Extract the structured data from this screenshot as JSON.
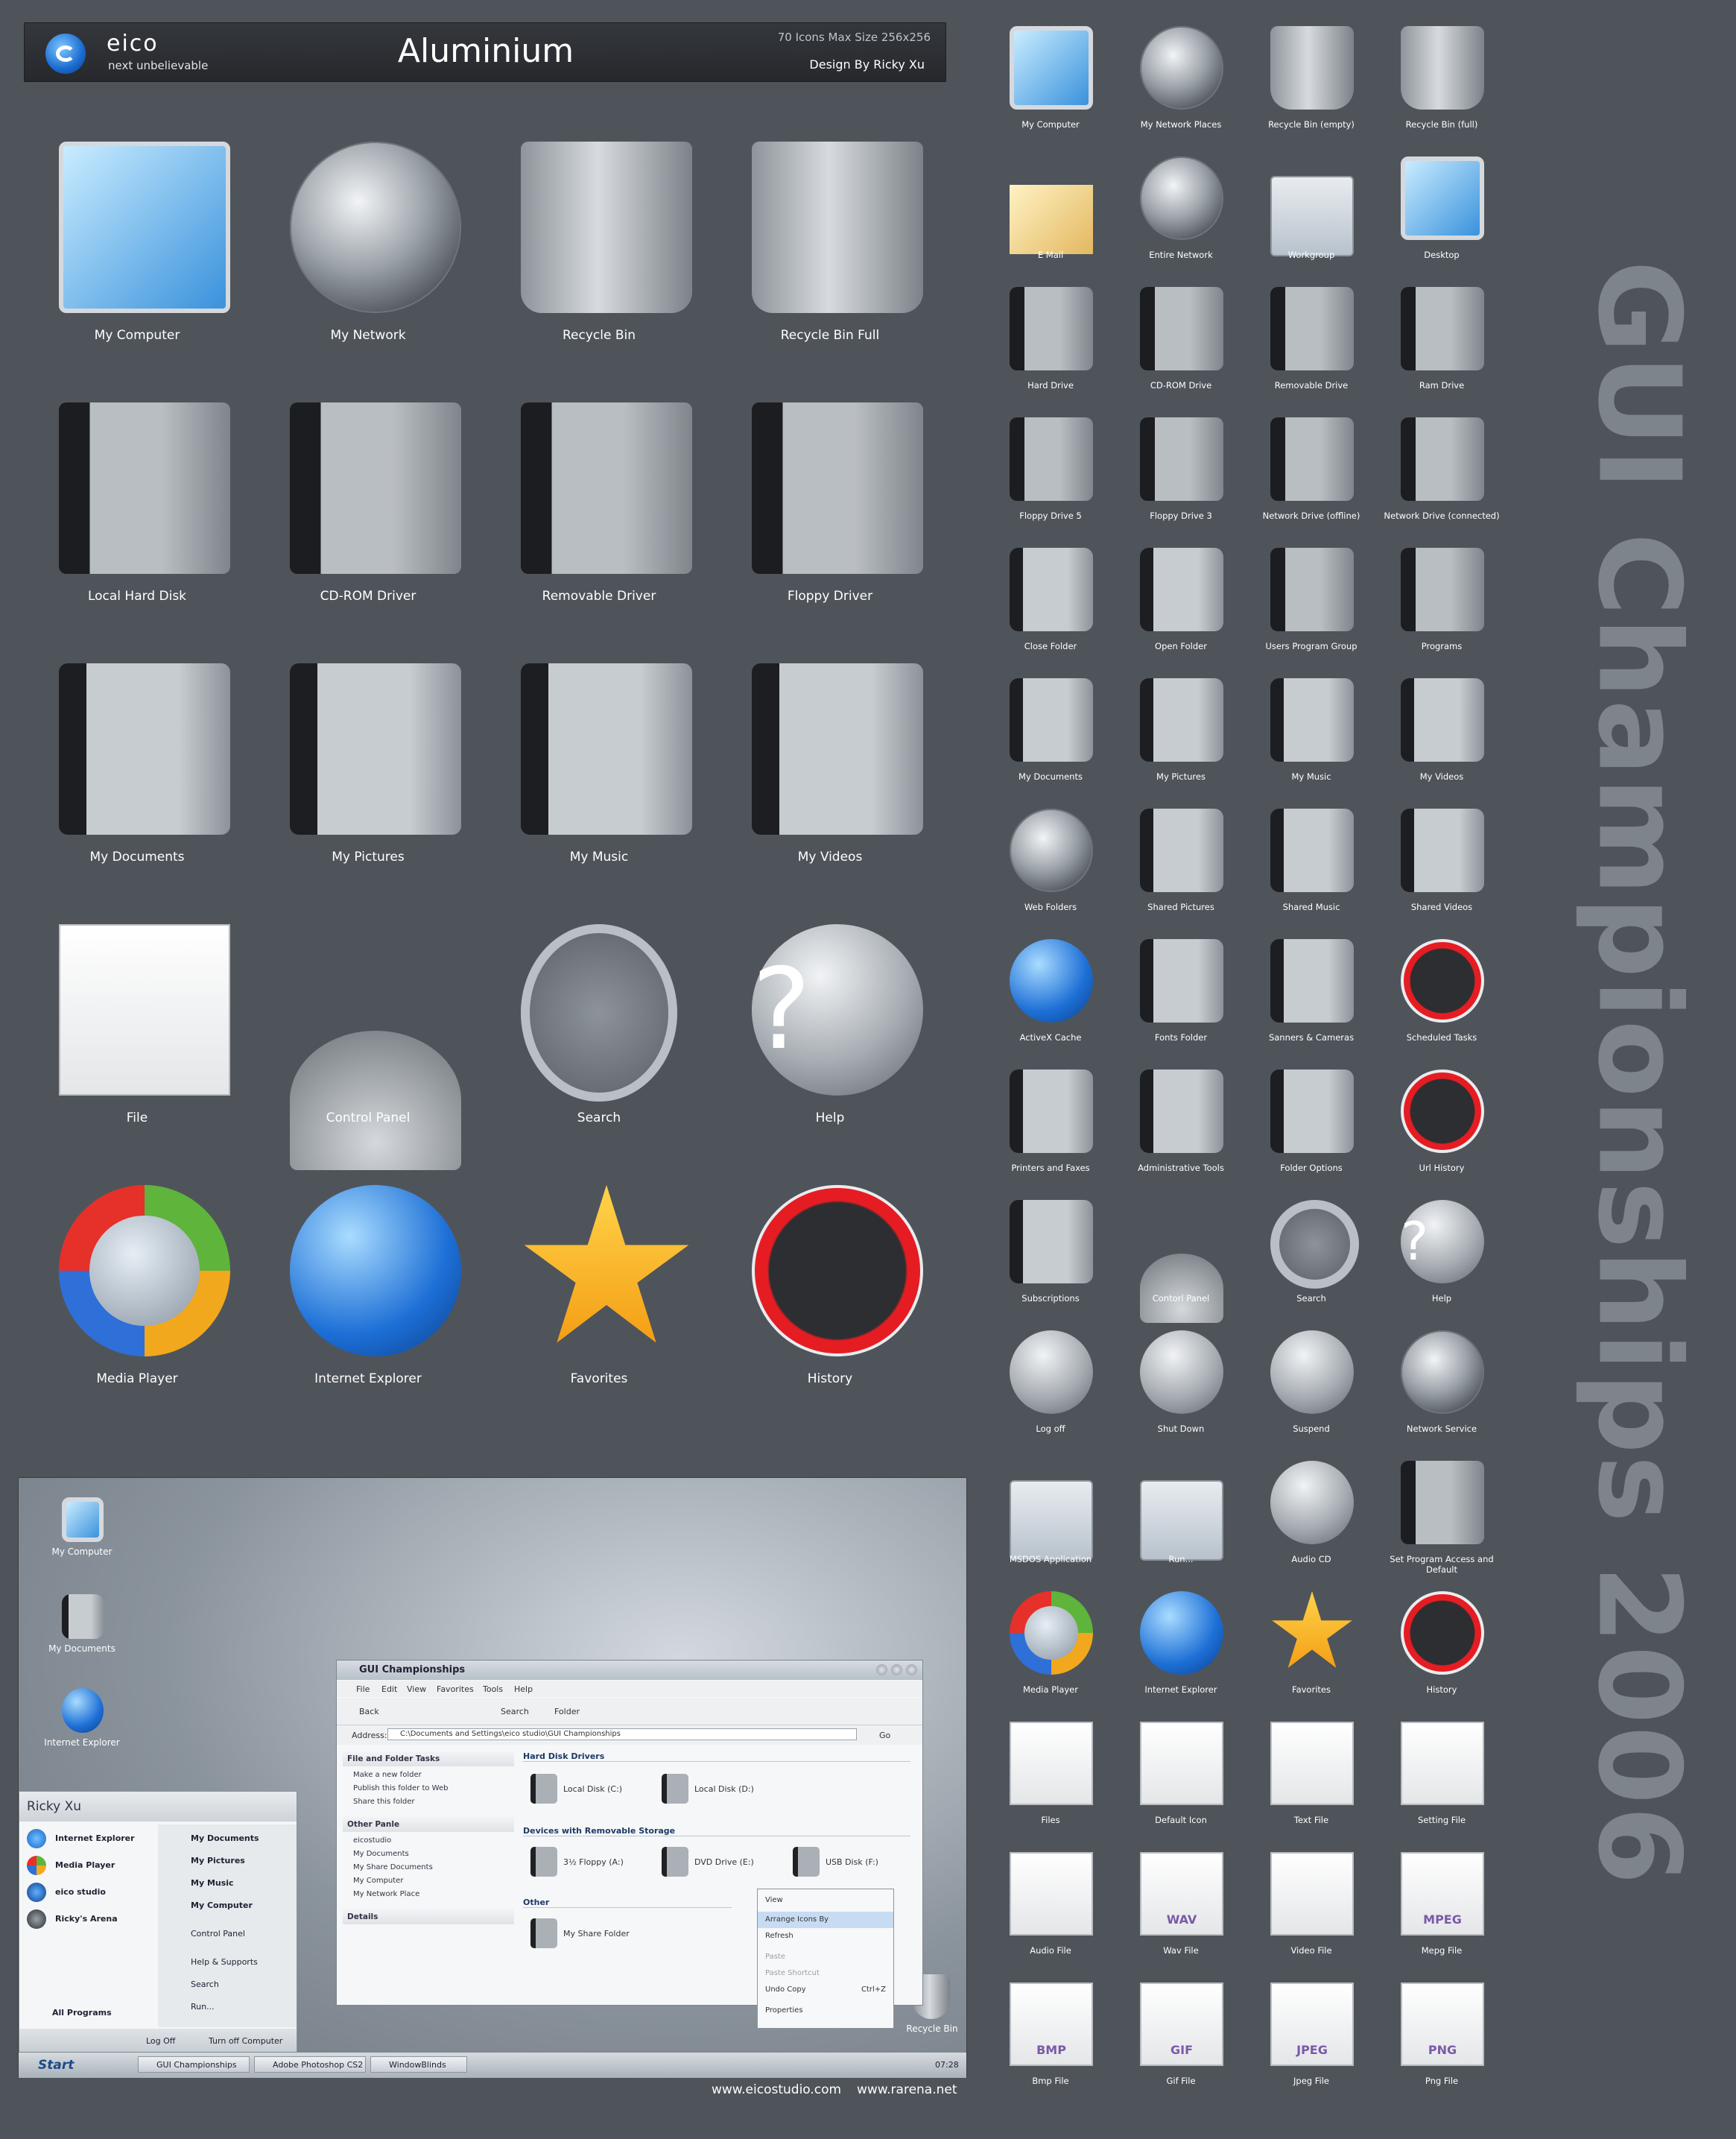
{
  "header": {
    "brand": "eico",
    "tagline": "next unbelievable",
    "title": "Aluminium",
    "meta_size": "70 Icons Max Size 256x256",
    "meta_design": "Design By Ricky Xu"
  },
  "side_title": "GUI Championships 2006",
  "big_icons": [
    {
      "label": "My Computer",
      "icon": "monitor-icon"
    },
    {
      "label": "My Network",
      "icon": "globe-icon"
    },
    {
      "label": "Recycle Bin",
      "icon": "recycle-bin-icon"
    },
    {
      "label": "Recycle Bin Full",
      "icon": "recycle-bin-full-icon"
    },
    {
      "label": "Local Hard Disk",
      "icon": "hard-disk-icon"
    },
    {
      "label": "CD-ROM Driver",
      "icon": "cdrom-drive-icon"
    },
    {
      "label": "Removable Driver",
      "icon": "usb-drive-icon"
    },
    {
      "label": "Floppy Driver",
      "icon": "floppy-drive-icon"
    },
    {
      "label": "My Documents",
      "icon": "documents-folder-icon"
    },
    {
      "label": "My Pictures",
      "icon": "pictures-folder-icon"
    },
    {
      "label": "My Music",
      "icon": "music-folder-icon"
    },
    {
      "label": "My Videos",
      "icon": "videos-folder-icon"
    },
    {
      "label": "File",
      "icon": "file-icon"
    },
    {
      "label": "Control Panel",
      "icon": "joystick-icon"
    },
    {
      "label": "Search",
      "icon": "magnifier-icon"
    },
    {
      "label": "Help",
      "icon": "help-icon"
    },
    {
      "label": "Media Player",
      "icon": "media-player-icon"
    },
    {
      "label": "Internet Explorer",
      "icon": "internet-explorer-icon"
    },
    {
      "label": "Favorites",
      "icon": "star-icon"
    },
    {
      "label": "History",
      "icon": "clock-icon"
    }
  ],
  "small_icons": [
    {
      "label": "My Computer",
      "icon": "monitor-icon"
    },
    {
      "label": "My Network Places",
      "icon": "globe-icon"
    },
    {
      "label": "Recycle Bin (empty)",
      "icon": "recycle-bin-icon"
    },
    {
      "label": "Recycle Bin (full)",
      "icon": "recycle-bin-full-icon"
    },
    {
      "label": "E Mail",
      "icon": "envelope-icon"
    },
    {
      "label": "Entire Network",
      "icon": "globe-icon"
    },
    {
      "label": "Workgroup",
      "icon": "workgroup-icon"
    },
    {
      "label": "Desktop",
      "icon": "desktop-icon"
    },
    {
      "label": "Hard Drive",
      "icon": "hard-disk-icon"
    },
    {
      "label": "CD-ROM Drive",
      "icon": "cdrom-drive-icon"
    },
    {
      "label": "Removable Drive",
      "icon": "usb-drive-icon"
    },
    {
      "label": "Ram Drive",
      "icon": "ram-drive-icon"
    },
    {
      "label": "Floppy Drive 5",
      "icon": "floppy-5-icon"
    },
    {
      "label": "Floppy Drive 3",
      "icon": "floppy-3-icon"
    },
    {
      "label": "Network Drive (offline)",
      "icon": "network-drive-offline-icon"
    },
    {
      "label": "Network Drive (connected)",
      "icon": "network-drive-connected-icon"
    },
    {
      "label": "Close Folder",
      "icon": "closed-folder-icon"
    },
    {
      "label": "Open Folder",
      "icon": "open-folder-icon"
    },
    {
      "label": "Users Program Group",
      "icon": "program-group-icon"
    },
    {
      "label": "Programs",
      "icon": "programs-icon"
    },
    {
      "label": "My Documents",
      "icon": "documents-folder-icon"
    },
    {
      "label": "My Pictures",
      "icon": "pictures-folder-icon"
    },
    {
      "label": "My Music",
      "icon": "music-folder-icon"
    },
    {
      "label": "My Videos",
      "icon": "videos-folder-icon"
    },
    {
      "label": "Web Folders",
      "icon": "web-folder-icon"
    },
    {
      "label": "Shared Pictures",
      "icon": "shared-pictures-icon"
    },
    {
      "label": "Shared Music",
      "icon": "shared-music-icon"
    },
    {
      "label": "Shared Videos",
      "icon": "shared-videos-icon"
    },
    {
      "label": "ActiveX Cache",
      "icon": "activex-folder-icon"
    },
    {
      "label": "Fonts Folder",
      "icon": "fonts-folder-icon"
    },
    {
      "label": "Sanners & Cameras",
      "icon": "camera-folder-icon"
    },
    {
      "label": "Scheduled Tasks",
      "icon": "scheduled-tasks-icon"
    },
    {
      "label": "Printers and Faxes",
      "icon": "printers-folder-icon"
    },
    {
      "label": "Administrative Tools",
      "icon": "admin-tools-icon"
    },
    {
      "label": "Folder Options",
      "icon": "folder-options-icon"
    },
    {
      "label": "Url History",
      "icon": "url-history-icon"
    },
    {
      "label": "Subscriptions",
      "icon": "subscriptions-icon"
    },
    {
      "label": "Contorl Panel",
      "icon": "joystick-icon"
    },
    {
      "label": "Search",
      "icon": "magnifier-icon"
    },
    {
      "label": "Help",
      "icon": "help-icon"
    },
    {
      "label": "Log off",
      "icon": "log-off-icon"
    },
    {
      "label": "Shut Down",
      "icon": "power-icon"
    },
    {
      "label": "Suspend",
      "icon": "moon-icon"
    },
    {
      "label": "Network Service",
      "icon": "network-service-icon"
    },
    {
      "label": "MSDOS Application",
      "icon": "msdos-window-icon"
    },
    {
      "label": "Run...",
      "icon": "run-window-icon"
    },
    {
      "label": "Audio CD",
      "icon": "audio-cd-icon"
    },
    {
      "label": "Set Program Access and Default",
      "icon": "program-access-icon"
    },
    {
      "label": "Media Player",
      "icon": "media-player-icon"
    },
    {
      "label": "Internet Explorer",
      "icon": "internet-explorer-icon"
    },
    {
      "label": "Favorites",
      "icon": "star-icon"
    },
    {
      "label": "History",
      "icon": "clock-icon"
    },
    {
      "label": "Files",
      "icon": "file-icon"
    },
    {
      "label": "Default Icon",
      "icon": "default-file-icon"
    },
    {
      "label": "Text File",
      "icon": "text-file-icon"
    },
    {
      "label": "Setting File",
      "icon": "setting-file-icon"
    },
    {
      "label": "Audio File",
      "icon": "audio-file-icon"
    },
    {
      "label": "Wav File",
      "icon": "wav-file-icon",
      "badge": "WAV"
    },
    {
      "label": "Video File",
      "icon": "video-file-icon"
    },
    {
      "label": "Mepg File",
      "icon": "mpeg-file-icon",
      "badge": "MPEG"
    },
    {
      "label": "Bmp File",
      "icon": "bmp-file-icon",
      "badge": "BMP"
    },
    {
      "label": "Gif File",
      "icon": "gif-file-icon",
      "badge": "GIF"
    },
    {
      "label": "Jpeg File",
      "icon": "jpeg-file-icon",
      "badge": "JPEG"
    },
    {
      "label": "Png File",
      "icon": "png-file-icon",
      "badge": "PNG"
    }
  ],
  "desktop": {
    "icons": [
      "My Computer",
      "My Documents",
      "Internet Explorer"
    ],
    "recycle_bin": "Recycle Bin",
    "explorer": {
      "title": "GUI Championships",
      "menu": [
        "File",
        "Edit",
        "View",
        "Favorites",
        "Tools",
        "Help"
      ],
      "toolbar": {
        "back": "Back",
        "search": "Search",
        "folder": "Folder"
      },
      "address_label": "Address:",
      "address_value": "C:\\Documents and Settings\\eico studio\\GUI Championships",
      "go": "Go",
      "tasks_header": "File and Folder Tasks",
      "tasks": [
        "Make a new folder",
        "Publish this folder to Web",
        "Share this folder"
      ],
      "other_header": "Other Panle",
      "other": [
        "eicostudio",
        "My Documents",
        "My Share Documents",
        "My Computer",
        "My Network Place"
      ],
      "details_header": "Details",
      "group_hdd": "Hard Disk Drivers",
      "hdd": [
        "Local Disk (C:)",
        "Local Disk (D:)"
      ],
      "group_removable": "Devices with Removable Storage",
      "removable": [
        "3½ Floppy (A:)",
        "DVD Drive (E:)",
        "USB Disk (F:)"
      ],
      "group_other": "Other",
      "other_items": [
        "My Share Folder"
      ],
      "context_menu": [
        "View",
        "Arrange Icons By",
        "Refresh",
        "Paste",
        "Paste Shortcut",
        "Undo Copy",
        "Properties"
      ],
      "context_shortcut": "Ctrl+Z"
    },
    "start_menu": {
      "user": "Ricky Xu",
      "left": [
        "Internet Explorer",
        "Media Player",
        "eico studio",
        "Ricky's Arena"
      ],
      "right_bold": [
        "My Documents",
        "My Pictures",
        "My Music",
        "My Computer"
      ],
      "right": [
        "Control Panel",
        "Help & Supports",
        "Search",
        "Run..."
      ],
      "all_programs": "All Programs",
      "log_off": "Log Off",
      "turn_off": "Turn off Computer"
    },
    "taskbar": {
      "start": "Start",
      "tasks": [
        "GUI Championships",
        "Adobe Photoshop CS2",
        "WindowBlinds"
      ],
      "clock": "07:28"
    }
  },
  "footer": {
    "site1": "www.eicostudio.com",
    "site2": "www.rarena.net"
  }
}
